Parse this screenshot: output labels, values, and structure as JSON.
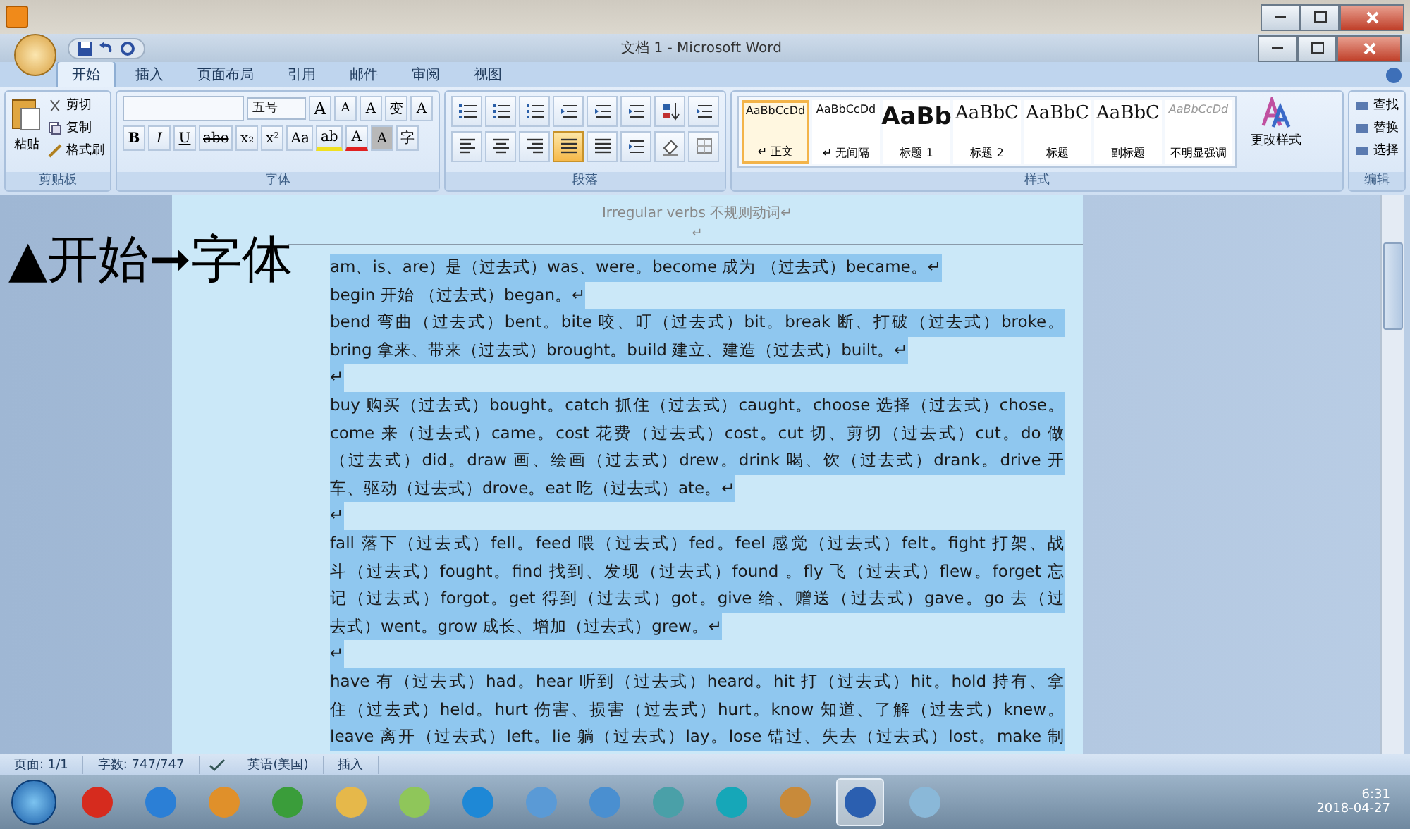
{
  "window": {
    "title": "文档 1 - Microsoft Word"
  },
  "tabs": [
    {
      "label": "开始",
      "selected": true
    },
    {
      "label": "插入",
      "selected": false
    },
    {
      "label": "页面布局",
      "selected": false
    },
    {
      "label": "引用",
      "selected": false
    },
    {
      "label": "邮件",
      "selected": false
    },
    {
      "label": "审阅",
      "selected": false
    },
    {
      "label": "视图",
      "selected": false
    }
  ],
  "clipboard": {
    "paste": "粘贴",
    "items": [
      "剪切",
      "复制",
      "格式刷"
    ],
    "label": "剪贴板"
  },
  "font": {
    "size": "五号",
    "row1": [
      {
        "kind": "grow",
        "text": "A"
      },
      {
        "kind": "shrink",
        "text": "A"
      },
      {
        "kind": "clear",
        "text": "A"
      },
      {
        "kind": "phonetic",
        "text": "变"
      },
      {
        "kind": "border",
        "text": "A"
      }
    ],
    "row2": [
      {
        "kind": "bold",
        "text": "B"
      },
      {
        "kind": "italic",
        "text": "I"
      },
      {
        "kind": "underline",
        "text": "U"
      },
      {
        "kind": "strike",
        "text": "abe"
      },
      {
        "kind": "sub",
        "text": "x₂"
      },
      {
        "kind": "sup",
        "text": "x²"
      },
      {
        "kind": "case",
        "text": "Aa"
      },
      {
        "kind": "highlight",
        "text": "ab"
      },
      {
        "kind": "color",
        "text": "A"
      },
      {
        "kind": "shade",
        "text": "A"
      },
      {
        "kind": "enclose",
        "text": "字"
      }
    ],
    "label": "字体"
  },
  "paragraph": {
    "row1": [
      {
        "kind": "bullets",
        "selected": false
      },
      {
        "kind": "numbering",
        "selected": false
      },
      {
        "kind": "multilevel",
        "selected": false
      },
      {
        "kind": "outdent",
        "selected": false
      },
      {
        "kind": "indent",
        "selected": false
      },
      {
        "kind": "asian",
        "selected": false
      },
      {
        "kind": "sort",
        "selected": false
      },
      {
        "kind": "marks",
        "selected": false
      }
    ],
    "row2": [
      {
        "kind": "left",
        "selected": false
      },
      {
        "kind": "center",
        "selected": false
      },
      {
        "kind": "right",
        "selected": false
      },
      {
        "kind": "justify",
        "selected": true
      },
      {
        "kind": "distribute",
        "selected": false
      },
      {
        "kind": "spacing",
        "selected": false
      },
      {
        "kind": "fill",
        "selected": false
      },
      {
        "kind": "borders",
        "selected": false
      }
    ],
    "label": "段落"
  },
  "styles": {
    "items": [
      {
        "sample": "AaBbCcDd",
        "name": "↵ 正文",
        "selected": true,
        "kind": "small"
      },
      {
        "sample": "AaBbCcDd",
        "name": "↵ 无间隔",
        "selected": false,
        "kind": "small"
      },
      {
        "sample": "AaBb",
        "name": "标题 1",
        "selected": false,
        "kind": "big"
      },
      {
        "sample": "AaBbC",
        "name": "标题 2",
        "selected": false,
        "kind": "medium"
      },
      {
        "sample": "AaBbC",
        "name": "标题",
        "selected": false,
        "kind": "medium"
      },
      {
        "sample": "AaBbC",
        "name": "副标题",
        "selected": false,
        "kind": "medium"
      },
      {
        "sample": "AaBbCcDd",
        "name": "不明显强调",
        "selected": false,
        "kind": "faint"
      }
    ],
    "change": "更改样式",
    "label": "样式"
  },
  "editing": {
    "items": [
      "查找",
      "替换",
      "选择"
    ],
    "label": "编辑"
  },
  "annotation": "▲开始➞字体",
  "document": {
    "header": "Irregular verbs  不规则动词↵",
    "header_mark": "↵",
    "paragraphs": [
      {
        "selected": true,
        "lines": [
          "am、is、are）是（过去式）was、were。become 成为 （过去式）became。↵"
        ]
      },
      {
        "selected": true,
        "lines": [
          "begin 开始 （过去式）began。↵"
        ]
      },
      {
        "selected": true,
        "lines": [
          "bend 弯曲（过去式）bent。bite 咬、叮（过去式）bit。break 断、打破（过去式）broke。",
          "bring 拿来、带来（过去式）brought。build 建立、建造（过去式）built。↵"
        ]
      },
      {
        "selected": true,
        "lines": [
          "↵"
        ]
      },
      {
        "selected": true,
        "lines": [
          "buy 购买（过去式）bought。catch 抓住（过去式）caught。choose 选择（过去式）chose。",
          "come 来（过去式）came。cost 花费（过去式）cost。cut 切、剪切（过去式）cut。do 做",
          "（过去式）did。draw 画、绘画（过去式）drew。drink 喝、饮（过去式）drank。drive 开",
          "车、驱动（过去式）drove。eat 吃（过去式）ate。↵"
        ]
      },
      {
        "selected": true,
        "lines": [
          "↵"
        ]
      },
      {
        "selected": true,
        "lines": [
          "fall 落下（过去式）fell。feed 喂（过去式）fed。feel 感觉（过去式）felt。fight 打架、战",
          "斗（过去式）fought。find 找到、发现（过去式）found 。fly 飞（过去式）flew。forget 忘",
          "记（过去式）forgot。get 得到（过去式）got。give 给、赠送（过去式）gave。go 去（过",
          "去式）went。grow 成长、增加（过去式）grew。↵"
        ]
      },
      {
        "selected": true,
        "lines": [
          "↵"
        ]
      },
      {
        "selected": true,
        "lines": [
          "have 有（过去式）had。hear 听到（过去式）heard。hit 打（过去式）hit。hold 持有、拿",
          "住（过去式）held。hurt 伤害、损害（过去式）hurt。know 知道、了解（过去式）knew。",
          "leave 离开（过去式）left。lie 躺（过去式）lay。lose 错过、失去（过去式）lost。make 制"
        ],
        "cut": true
      }
    ]
  },
  "status_bar": {
    "page": "页面: 1/1",
    "words": "字数: 747/747",
    "language": "英语(美国)",
    "mode": "插入"
  },
  "taskbar": {
    "apps": [
      {
        "selected": false
      },
      {
        "selected": false
      },
      {
        "selected": false
      },
      {
        "selected": false
      },
      {
        "selected": false
      },
      {
        "selected": false
      },
      {
        "selected": false
      },
      {
        "selected": false
      },
      {
        "selected": false
      },
      {
        "selected": false
      },
      {
        "selected": false
      },
      {
        "selected": false
      },
      {
        "selected": true
      },
      {
        "selected": false
      }
    ],
    "time": "6:31",
    "date": "2018-04-27"
  }
}
